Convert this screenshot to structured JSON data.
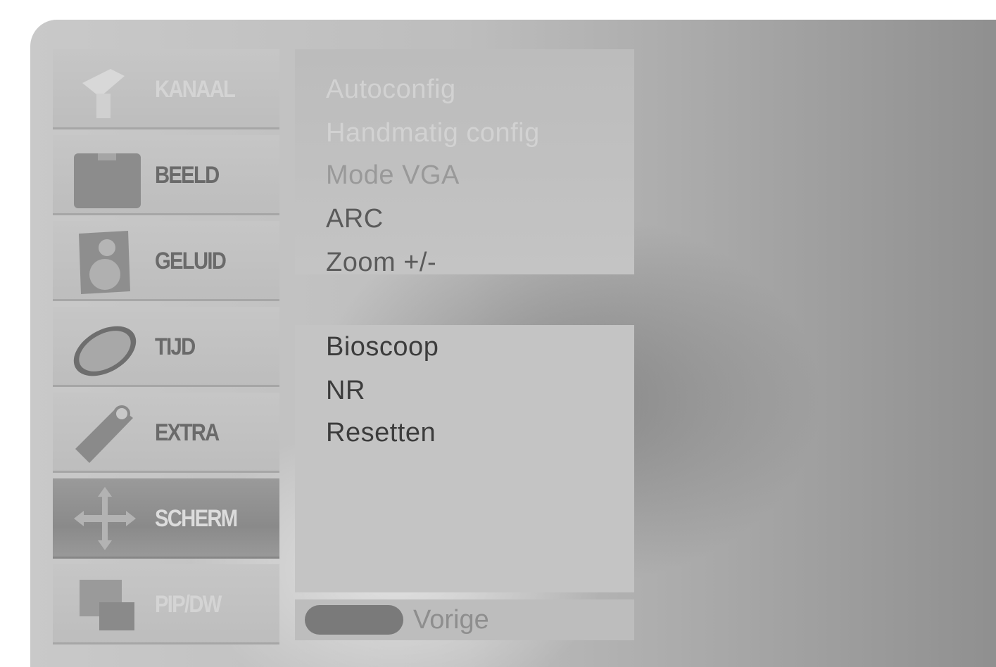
{
  "sidebar": {
    "items": [
      {
        "label": "KANAAL",
        "icon": "antenna-icon"
      },
      {
        "label": "BEELD",
        "icon": "picture-icon"
      },
      {
        "label": "GELUID",
        "icon": "speaker-icon"
      },
      {
        "label": "TIJD",
        "icon": "clock-icon"
      },
      {
        "label": "EXTRA",
        "icon": "tag-icon"
      },
      {
        "label": "SCHERM",
        "icon": "move-arrows-icon"
      },
      {
        "label": "PIP/DW",
        "icon": "pip-icon"
      }
    ],
    "active_index": 5
  },
  "submenu_top": {
    "items": [
      {
        "label": "Autoconfig"
      },
      {
        "label": "Handmatig config"
      },
      {
        "label": "Mode VGA"
      },
      {
        "label": "ARC"
      },
      {
        "label": "Zoom +/-"
      }
    ]
  },
  "submenu_bottom": {
    "items": [
      {
        "label": "Bioscoop"
      },
      {
        "label": "NR"
      },
      {
        "label": "Resetten"
      }
    ]
  },
  "footer": {
    "back_label": "Vorige"
  }
}
